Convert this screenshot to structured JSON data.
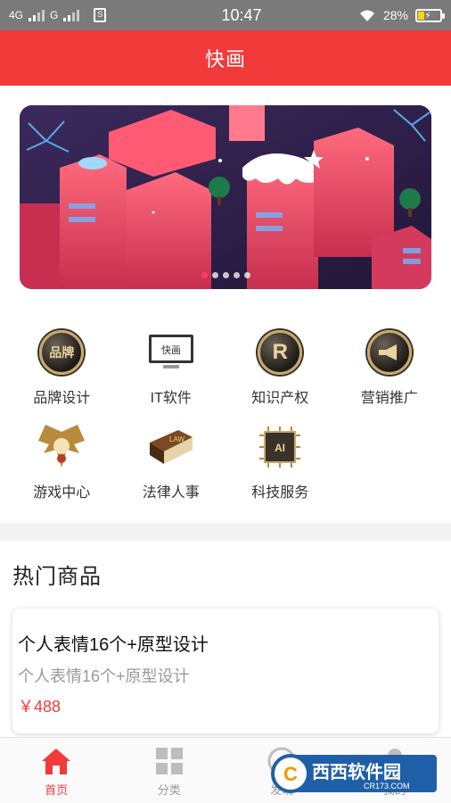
{
  "status_bar": {
    "network1": "4G",
    "network2": "G",
    "sim_icon": "sim-card-icon",
    "time": "10:47",
    "battery_percent": "28%",
    "battery_level": 0.28
  },
  "header": {
    "title": "快画"
  },
  "banner": {
    "slide_count": 5,
    "active_index": 0
  },
  "categories": [
    {
      "label": "品牌设计",
      "icon": "brand-medal-icon",
      "icon_text": "品牌"
    },
    {
      "label": "IT软件",
      "icon": "monitor-icon",
      "icon_text": "快画"
    },
    {
      "label": "知识产权",
      "icon": "r-medal-icon",
      "icon_text": "R"
    },
    {
      "label": "营销推广",
      "icon": "megaphone-icon"
    },
    {
      "label": "游戏中心",
      "icon": "eagle-emblem-icon"
    },
    {
      "label": "法律人事",
      "icon": "law-book-icon",
      "icon_text": "LAW"
    },
    {
      "label": "科技服务",
      "icon": "ai-chip-icon",
      "icon_text": "AI"
    }
  ],
  "hot_section": {
    "title": "热门商品",
    "products": [
      {
        "title": "个人表情16个+原型设计",
        "subtitle": "个人表情16个+原型设计",
        "price": "￥488"
      }
    ]
  },
  "bottom_nav": [
    {
      "label": "首页",
      "icon": "home-icon",
      "active": true
    },
    {
      "label": "分类",
      "icon": "grid-icon",
      "active": false
    },
    {
      "label": "发现",
      "icon": "compass-icon",
      "active": false
    },
    {
      "label": "我的",
      "icon": "user-icon",
      "active": false
    }
  ],
  "watermark": {
    "text": "西西软件园",
    "url_text": "CR173.COM"
  },
  "colors": {
    "accent": "#f23a3a",
    "status_bar": "#7a7a7a",
    "price": "#f23a3a"
  }
}
